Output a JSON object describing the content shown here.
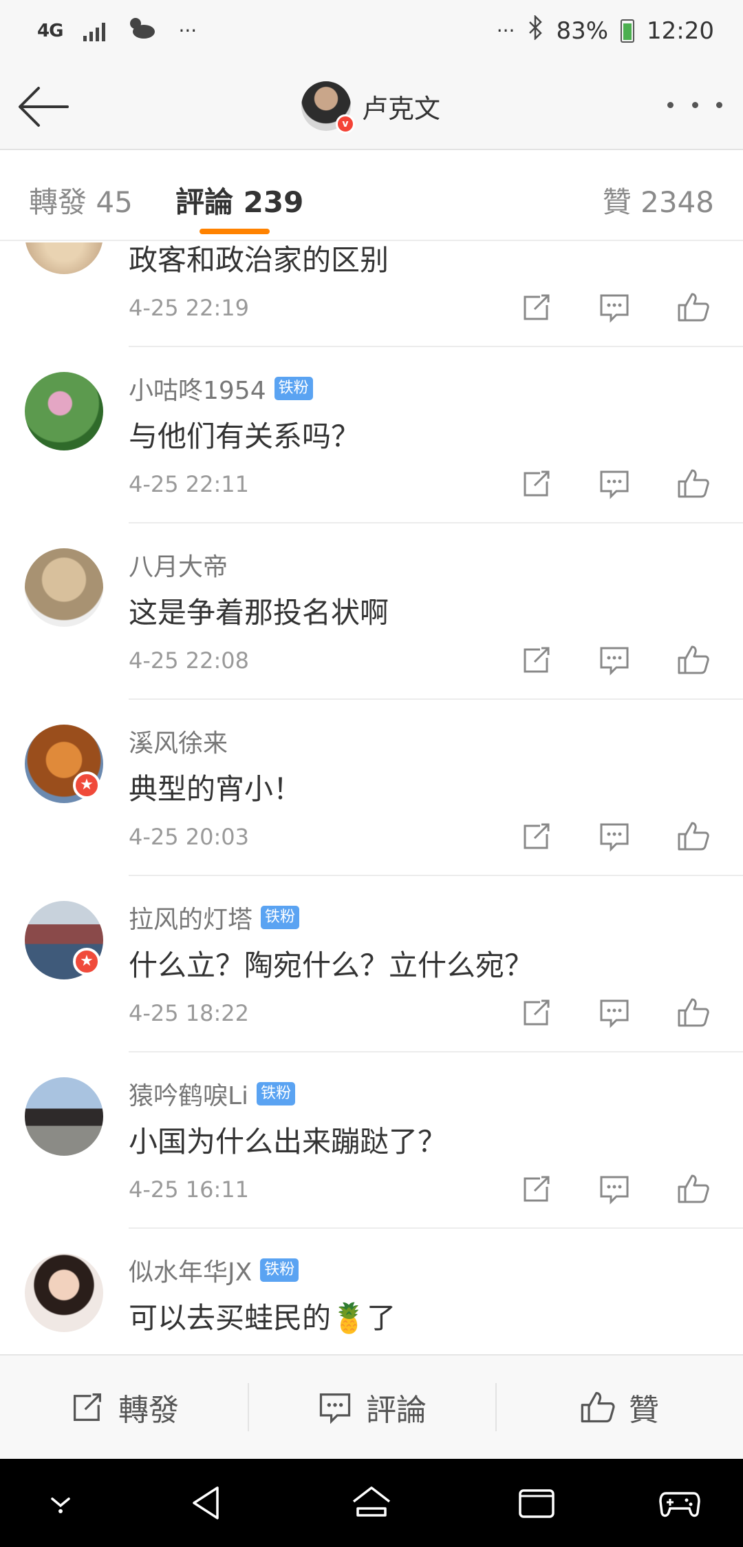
{
  "status_bar": {
    "network": "4G",
    "dots_left": "···",
    "dots_right": "···",
    "battery": "83%",
    "time": "12:20"
  },
  "header": {
    "user_name": "卢克文",
    "verified_mark": "v"
  },
  "tabs": {
    "repost": "轉發 45",
    "comments": "評論 239",
    "likes": "贊 2348"
  },
  "comments": [
    {
      "name": "",
      "badge": "",
      "text": "政客和政治家的区别",
      "time": "4-25 22:19",
      "avatar_color": "#d9c4a8"
    },
    {
      "name": "小咕咚1954",
      "badge": "铁粉",
      "text": "与他们有关系吗？",
      "time": "4-25 22:11",
      "avatar_color": "#4f8f46"
    },
    {
      "name": "八月大帝",
      "badge": "",
      "text": "这是争着那投名状啊",
      "time": "4-25 22:08",
      "avatar_color": "#c9b08c"
    },
    {
      "name": "溪风徐来",
      "badge": "",
      "text": "典型的宵小！",
      "time": "4-25 20:03",
      "avatar_color": "#b8652a"
    },
    {
      "name": "拉风的灯塔",
      "badge": "铁粉",
      "text": "什么立？陶宛什么？立什么宛？",
      "time": "4-25 18:22",
      "avatar_color": "#7a5a52"
    },
    {
      "name": "猿吟鹤唳Li",
      "badge": "铁粉",
      "text": "小国为什么出来蹦跶了？",
      "time": "4-25 16:11",
      "avatar_color": "#6b7f99"
    },
    {
      "name": "似水年华JX",
      "badge": "铁粉",
      "text": "可以去买蛙民的🍍了",
      "time": "",
      "avatar_color": "#3c2b25"
    }
  ],
  "bottom_bar": {
    "repost": "轉發",
    "comment": "評論",
    "like": "贊"
  }
}
